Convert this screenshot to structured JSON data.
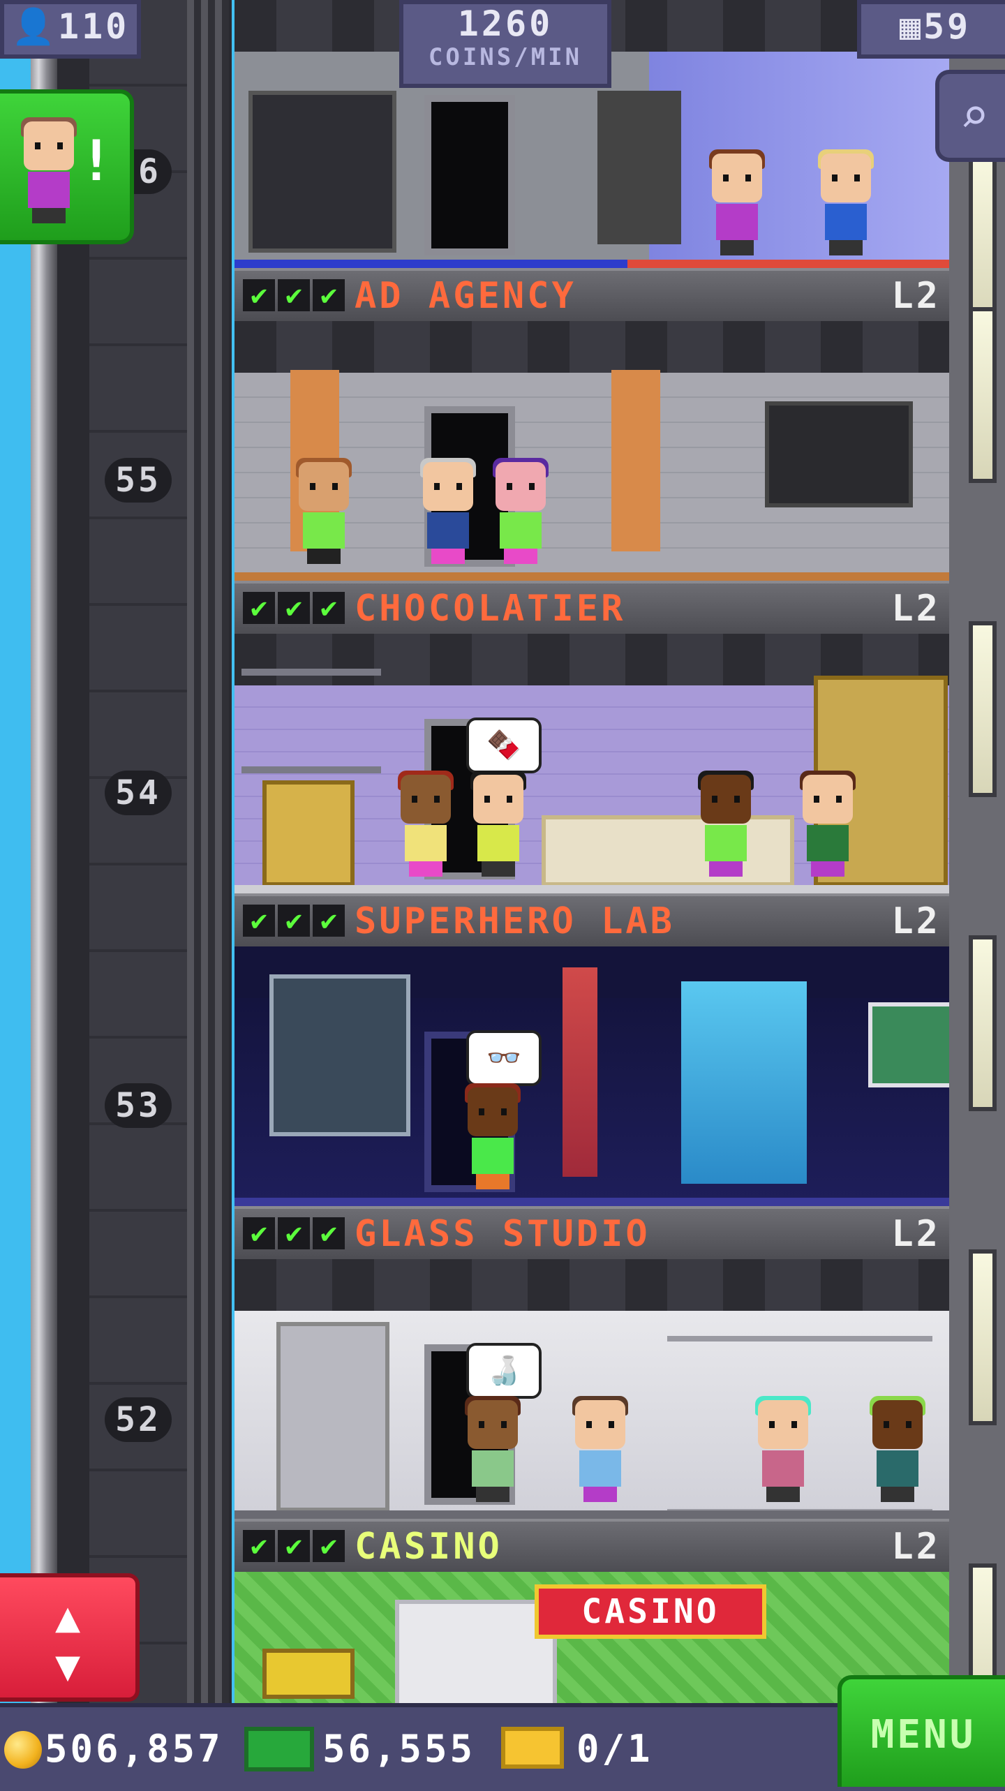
{
  "hud": {
    "population": "110",
    "coins_per_min_value": "1260",
    "coins_per_min_label": "COINS/MIN",
    "floor_count": "59"
  },
  "floor_numbers": [
    "56",
    "55",
    "54",
    "53",
    "52"
  ],
  "floors": [
    {
      "name": "AD AGENCY",
      "level": "L2",
      "checks": [
        "✔",
        "✔",
        "✔"
      ]
    },
    {
      "name": "CHOCOLATIER",
      "level": "L2",
      "checks": [
        "✔",
        "✔",
        "✔"
      ]
    },
    {
      "name": "SUPERHERO LAB",
      "level": "L2",
      "checks": [
        "✔",
        "✔",
        "✔"
      ]
    },
    {
      "name": "GLASS STUDIO",
      "level": "L2",
      "checks": [
        "✔",
        "✔",
        "✔"
      ]
    },
    {
      "name": "CASINO",
      "level": "L2",
      "checks": [
        "✔",
        "✔",
        "✔"
      ]
    }
  ],
  "casino_sign": "CASINO",
  "bubbles": {
    "chocolatier": "🍫",
    "superhero": "👓",
    "glass": "🍶"
  },
  "notification": {
    "mark": "!"
  },
  "elevator_button": {
    "icon": "▲\n▼"
  },
  "zoom_button": {
    "icon": "⌕"
  },
  "bottom_bar": {
    "coins": "506,857",
    "bux": "56,555",
    "tickets": "0/1",
    "menu_label": "MENU"
  },
  "colors": {
    "floor_name": "#ff6a3d",
    "floor_name_highlight": "#e8ff7a",
    "check_green": "#5cff3c",
    "hud_purple": "#5b5a86",
    "menu_green": "#2fbf2a",
    "elevator_red": "#e8283f"
  }
}
